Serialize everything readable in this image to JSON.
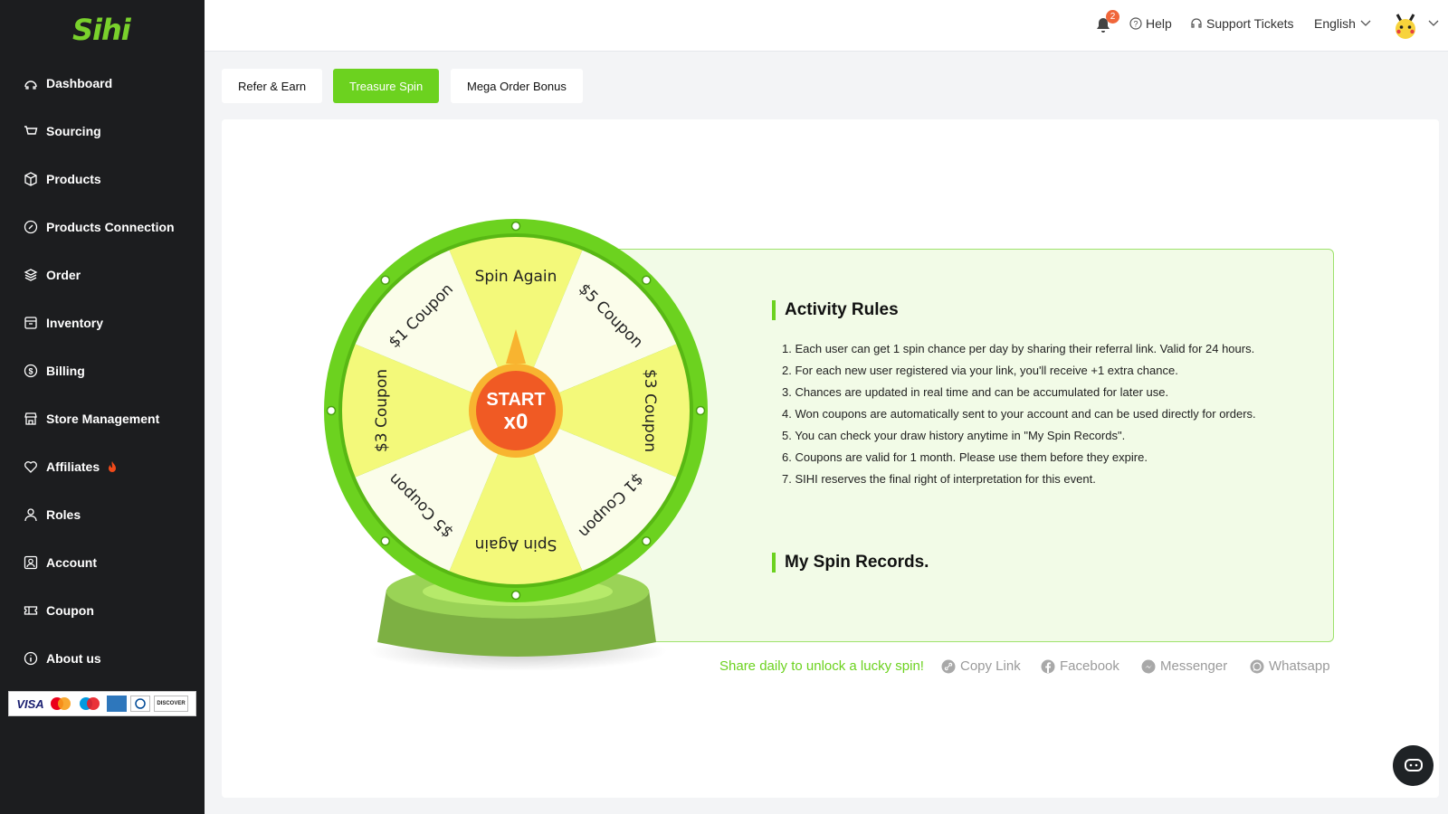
{
  "app": {
    "logo": "Sihi"
  },
  "sidebar": {
    "items": [
      {
        "label": "Dashboard",
        "icon": "dashboard-icon"
      },
      {
        "label": "Sourcing",
        "icon": "cart-icon"
      },
      {
        "label": "Products",
        "icon": "box-icon"
      },
      {
        "label": "Products Connection",
        "icon": "link-icon"
      },
      {
        "label": "Order",
        "icon": "layers-icon"
      },
      {
        "label": "Inventory",
        "icon": "archive-icon"
      },
      {
        "label": "Billing",
        "icon": "dollar-icon"
      },
      {
        "label": "Store Management",
        "icon": "store-icon"
      },
      {
        "label": "Affiliates",
        "icon": "heart-icon",
        "badge": "fire-icon"
      },
      {
        "label": "Roles",
        "icon": "user-icon"
      },
      {
        "label": "Account",
        "icon": "account-icon"
      },
      {
        "label": "Coupon",
        "icon": "ticket-icon"
      },
      {
        "label": "About us",
        "icon": "info-icon"
      }
    ],
    "payment_cards": [
      "VISA",
      "Mastercard",
      "Maestro",
      "American Express",
      "Diners Club",
      "DISCOVER"
    ]
  },
  "topbar": {
    "notification_count": "2",
    "help": "Help",
    "support": "Support Tickets",
    "language": "English"
  },
  "tabs": [
    {
      "label": "Refer & Earn",
      "active": false
    },
    {
      "label": "Treasure Spin",
      "active": true
    },
    {
      "label": "Mega Order Bonus",
      "active": false
    }
  ],
  "wheel": {
    "segments": [
      "Spin Again",
      "$5 Coupon",
      "$3 Coupon",
      "$1 Coupon",
      "Spin Again",
      "$5 Coupon",
      "$3 Coupon",
      "$1 Coupon"
    ],
    "start_label": "START",
    "chances": "x0",
    "colors": {
      "rim": "#6cd21f",
      "yellow": "#f3f97a",
      "cream": "#fbfdea",
      "hub": "#f36b2a"
    }
  },
  "rules": {
    "title": "Activity Rules",
    "items": [
      "1. Each user can get 1 spin chance per day by sharing their referral link. Valid for 24 hours.",
      "2. For each new user registered via your link, you'll receive +1 extra chance.",
      "3. Chances are updated in real time and can be accumulated for later use.",
      "4. Won coupons are automatically sent to your account and can be used directly for orders.",
      "5. You can check your draw history anytime in \"My Spin Records\".",
      "6. Coupons are valid for 1 month. Please use them before they expire.",
      "7. SIHI reserves the final right of interpretation for this event."
    ],
    "records_title": "My Spin Records."
  },
  "share": {
    "prompt": "Share daily to unlock a lucky spin!",
    "copy_link": "Copy Link",
    "facebook": "Facebook",
    "messenger": "Messenger",
    "whatsapp": "Whatsapp",
    "accent": "#6cd21f"
  }
}
